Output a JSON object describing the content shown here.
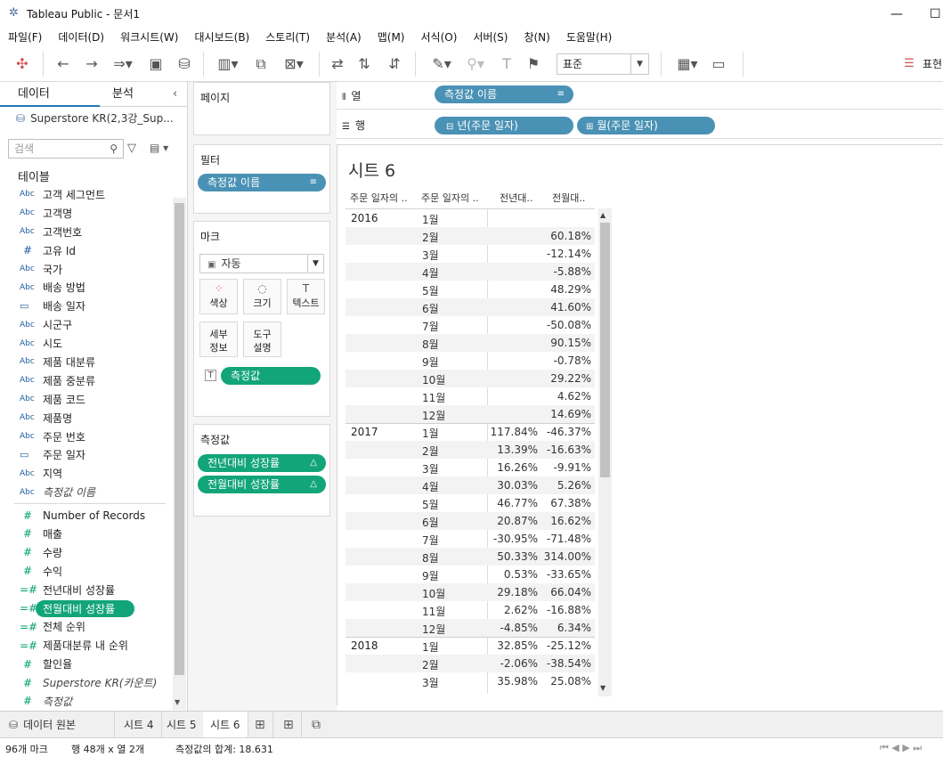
{
  "window": {
    "title": "Tableau Public - 문서1"
  },
  "menu": [
    "파일(F)",
    "데이터(D)",
    "워크시트(W)",
    "대시보드(B)",
    "스토리(T)",
    "분석(A)",
    "맵(M)",
    "서식(O)",
    "서버(S)",
    "창(N)",
    "도움말(H)"
  ],
  "toolbar": {
    "fit_select": "표준",
    "show_me_label": "표현"
  },
  "left_pane": {
    "tab_data": "데이터",
    "tab_analysis": "분석",
    "datasource": "Superstore KR(2,3강_Sup...",
    "search_placeholder": "검색",
    "section_tables": "테이블",
    "dimensions": [
      {
        "icon": "Abc",
        "label": "고객 세그먼트"
      },
      {
        "icon": "Abc",
        "label": "고객명"
      },
      {
        "icon": "Abc",
        "label": "고객번호"
      },
      {
        "icon": "#",
        "label": "고유 Id"
      },
      {
        "icon": "Abc",
        "label": "국가"
      },
      {
        "icon": "Abc",
        "label": "배송 방법"
      },
      {
        "icon": "date",
        "label": "배송 일자"
      },
      {
        "icon": "Abc",
        "label": "시군구"
      },
      {
        "icon": "Abc",
        "label": "시도"
      },
      {
        "icon": "Abc",
        "label": "제품 대분류"
      },
      {
        "icon": "Abc",
        "label": "제품 중분류"
      },
      {
        "icon": "Abc",
        "label": "제품 코드"
      },
      {
        "icon": "Abc",
        "label": "제품명"
      },
      {
        "icon": "Abc",
        "label": "주문 번호"
      },
      {
        "icon": "date",
        "label": "주문 일자"
      },
      {
        "icon": "Abc",
        "label": "지역"
      },
      {
        "icon": "Abc",
        "label": "측정값 이름",
        "italic": true
      }
    ],
    "measures": [
      {
        "icon": "#",
        "label": "Number of Records"
      },
      {
        "icon": "#",
        "label": "매출"
      },
      {
        "icon": "#",
        "label": "수량"
      },
      {
        "icon": "#",
        "label": "수익"
      },
      {
        "icon": "=#",
        "label": "전년대비 성장률"
      },
      {
        "icon": "=#",
        "label": "전월대비 성장률",
        "selected": true
      },
      {
        "icon": "=#",
        "label": "전체 순위"
      },
      {
        "icon": "=#",
        "label": "제품대분류 내 순위"
      },
      {
        "icon": "#",
        "label": "할인율"
      },
      {
        "icon": "#",
        "label": "Superstore KR(카운트)",
        "italic": true
      },
      {
        "icon": "#",
        "label": "측정값",
        "italic": true
      }
    ]
  },
  "cards": {
    "pages": "페이지",
    "filters": "필터",
    "filter_pill": "측정값 이름",
    "marks": "마크",
    "marks_type": "자동",
    "marks_buttons": {
      "color": "색상",
      "size": "크기",
      "text": "텍스트",
      "detail_1": "세부",
      "detail_2": "정보",
      "tooltip_1": "도구",
      "tooltip_2": "설명"
    },
    "marks_pill": "측정값",
    "measure_values": "측정값",
    "measure_pills": [
      "전년대비 성장률",
      "전월대비 성장률"
    ]
  },
  "shelves": {
    "columns_label": "열",
    "rows_label": "행",
    "columns_pill": "측정값 이름",
    "rows_pills": [
      "년(주문 일자)",
      "월(주문 일자)"
    ]
  },
  "sheet": {
    "title": "시트 6",
    "headers": [
      "주문 일자의 ..",
      "주문 일자의 ..",
      "전년대..",
      "전월대.."
    ],
    "rows": [
      {
        "year": "2016",
        "month": "1월",
        "yoy": "",
        "mom": ""
      },
      {
        "year": "",
        "month": "2월",
        "yoy": "",
        "mom": "60.18%"
      },
      {
        "year": "",
        "month": "3월",
        "yoy": "",
        "mom": "-12.14%"
      },
      {
        "year": "",
        "month": "4월",
        "yoy": "",
        "mom": "-5.88%"
      },
      {
        "year": "",
        "month": "5월",
        "yoy": "",
        "mom": "48.29%"
      },
      {
        "year": "",
        "month": "6월",
        "yoy": "",
        "mom": "41.60%"
      },
      {
        "year": "",
        "month": "7월",
        "yoy": "",
        "mom": "-50.08%"
      },
      {
        "year": "",
        "month": "8월",
        "yoy": "",
        "mom": "90.15%"
      },
      {
        "year": "",
        "month": "9월",
        "yoy": "",
        "mom": "-0.78%"
      },
      {
        "year": "",
        "month": "10월",
        "yoy": "",
        "mom": "29.22%"
      },
      {
        "year": "",
        "month": "11월",
        "yoy": "",
        "mom": "4.62%"
      },
      {
        "year": "",
        "month": "12월",
        "yoy": "",
        "mom": "14.69%"
      },
      {
        "year": "2017",
        "month": "1월",
        "yoy": "117.84%",
        "mom": "-46.37%"
      },
      {
        "year": "",
        "month": "2월",
        "yoy": "13.39%",
        "mom": "-16.63%"
      },
      {
        "year": "",
        "month": "3월",
        "yoy": "16.26%",
        "mom": "-9.91%"
      },
      {
        "year": "",
        "month": "4월",
        "yoy": "30.03%",
        "mom": "5.26%"
      },
      {
        "year": "",
        "month": "5월",
        "yoy": "46.77%",
        "mom": "67.38%"
      },
      {
        "year": "",
        "month": "6월",
        "yoy": "20.87%",
        "mom": "16.62%"
      },
      {
        "year": "",
        "month": "7월",
        "yoy": "-30.95%",
        "mom": "-71.48%"
      },
      {
        "year": "",
        "month": "8월",
        "yoy": "50.33%",
        "mom": "314.00%"
      },
      {
        "year": "",
        "month": "9월",
        "yoy": "0.53%",
        "mom": "-33.65%"
      },
      {
        "year": "",
        "month": "10월",
        "yoy": "29.18%",
        "mom": "66.04%"
      },
      {
        "year": "",
        "month": "11월",
        "yoy": "2.62%",
        "mom": "-16.88%"
      },
      {
        "year": "",
        "month": "12월",
        "yoy": "-4.85%",
        "mom": "6.34%"
      },
      {
        "year": "2018",
        "month": "1월",
        "yoy": "32.85%",
        "mom": "-25.12%"
      },
      {
        "year": "",
        "month": "2월",
        "yoy": "-2.06%",
        "mom": "-38.54%"
      },
      {
        "year": "",
        "month": "3월",
        "yoy": "35.98%",
        "mom": "25.08%"
      }
    ]
  },
  "bottom_tabs": {
    "datasource": "데이터 원본",
    "sheets": [
      "시트 4",
      "시트 5",
      "시트 6"
    ],
    "active": "시트 6"
  },
  "status": {
    "marks": "96개 마크",
    "rows_cols": "행 48개 x 열 2개",
    "sum": "측정값의 합계: 18.631"
  }
}
